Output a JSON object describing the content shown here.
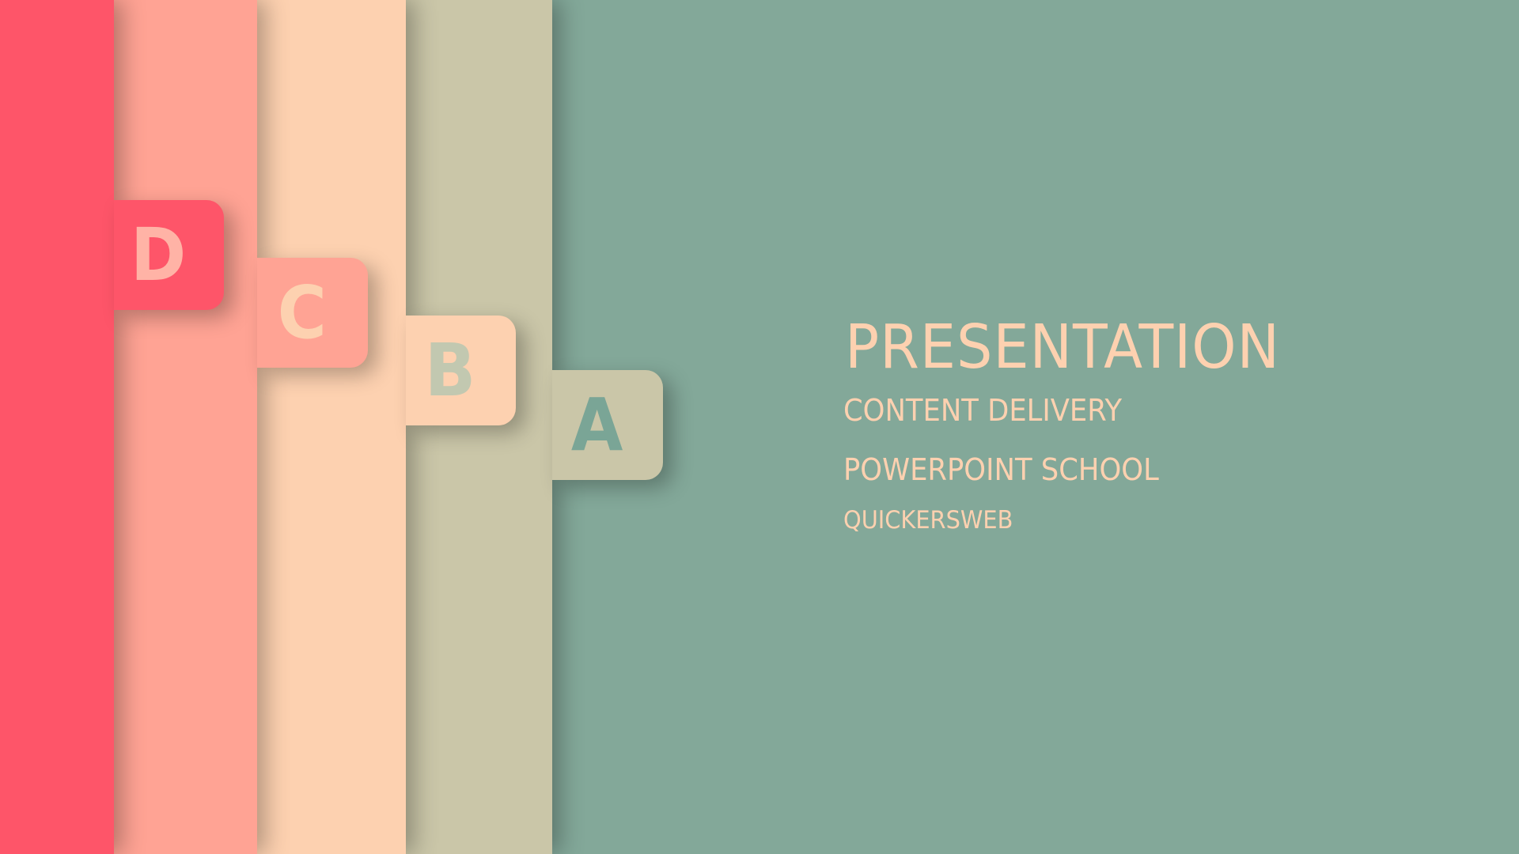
{
  "colors": {
    "background": "#83a899",
    "strip_a": "#cac6a8",
    "strip_b": "#fdd1b0",
    "strip_c": "#ffa394",
    "strip_d": "#fe5569",
    "text": "#fdd1b0"
  },
  "tabs": {
    "a": "A",
    "b": "B",
    "c": "C",
    "d": "D"
  },
  "text": {
    "title": "PRESENTATION",
    "line1": "CONTENT DELIVERY",
    "line2": "POWERPOINT SCHOOL",
    "line3": "QUICKERSWEB"
  }
}
